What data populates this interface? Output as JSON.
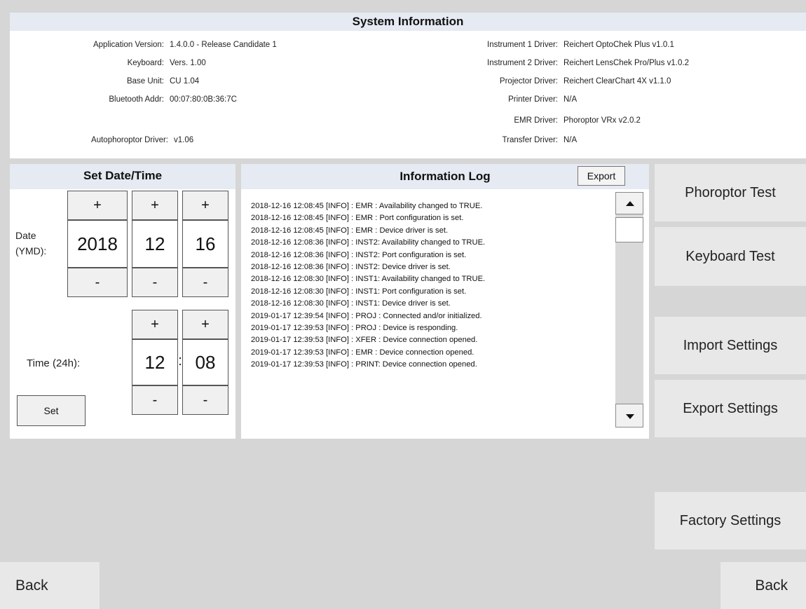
{
  "system_info": {
    "title": "System Information",
    "left": [
      {
        "label": "Application Version:",
        "value": "1.4.0.0 - Release Candidate 1"
      },
      {
        "label": "Keyboard:",
        "value": "Vers. 1.00"
      },
      {
        "label": "Base Unit:",
        "value": "CU 1.04"
      },
      {
        "label": "Bluetooth Addr:",
        "value": "00:07:80:0B:36:7C"
      }
    ],
    "autophoroptor": {
      "label": "Autophoroptor Driver:",
      "value": "v1.06"
    },
    "right": [
      {
        "label": "Instrument 1 Driver:",
        "value": "Reichert OptoChek Plus  v1.0.1"
      },
      {
        "label": "Instrument 2 Driver:",
        "value": "Reichert LensChek Pro/Plus  v1.0.2"
      },
      {
        "label": "Projector Driver:",
        "value": "Reichert ClearChart 4X  v1.1.0"
      },
      {
        "label": "Printer Driver:",
        "value": "N/A"
      },
      {
        "label": "EMR Driver:",
        "value": "Phoroptor VRx  v2.0.2"
      },
      {
        "label": "Transfer Driver:",
        "value": "N/A"
      }
    ]
  },
  "datetime": {
    "title": "Set Date/Time",
    "plus": "+",
    "minus": "-",
    "date_label_1": "Date",
    "date_label_2": "(YMD):",
    "year": "2018",
    "month": "12",
    "day": "16",
    "time_label": "Time (24h):",
    "hour": "12",
    "colon": ":",
    "minute": "08",
    "set_label": "Set"
  },
  "log": {
    "title": "Information Log",
    "export_label": "Export",
    "lines": [
      "2018-12-16 12:08:45 [INFO] : EMR  : Availability changed to TRUE.",
      "2018-12-16 12:08:45 [INFO] : EMR  : Port configuration is set.",
      "2018-12-16 12:08:45 [INFO] : EMR  : Device driver is set.",
      "2018-12-16 12:08:36 [INFO] : INST2: Availability changed to TRUE.",
      "2018-12-16 12:08:36 [INFO] : INST2: Port configuration is set.",
      "2018-12-16 12:08:36 [INFO] : INST2: Device driver is set.",
      "2018-12-16 12:08:30 [INFO] : INST1: Availability changed to TRUE.",
      "2018-12-16 12:08:30 [INFO] : INST1: Port configuration is set.",
      "2018-12-16 12:08:30 [INFO] : INST1: Device driver is set.",
      "2019-01-17 12:39:54 [INFO] : PROJ : Connected and/or initialized.",
      "2019-01-17 12:39:53 [INFO] : PROJ : Device is responding.",
      "2019-01-17 12:39:53 [INFO] : XFER : Device connection opened.",
      "2019-01-17 12:39:53 [INFO] : EMR  : Device connection opened.",
      "2019-01-17 12:39:53 [INFO] : PRINT: Device connection opened."
    ]
  },
  "buttons": {
    "phoroptor_test": "Phoroptor Test",
    "keyboard_test": "Keyboard Test",
    "import_settings": "Import Settings",
    "export_settings": "Export Settings",
    "factory_settings": "Factory Settings",
    "back": "Back"
  }
}
